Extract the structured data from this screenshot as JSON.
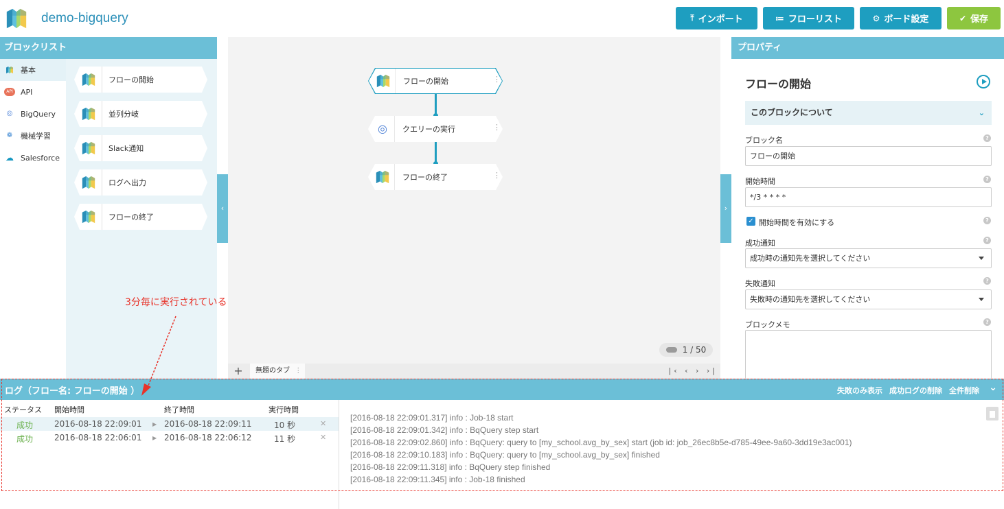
{
  "app": {
    "title": "demo-bigquery"
  },
  "header": {
    "import_label": "インポート",
    "flowlist_label": "フローリスト",
    "board_label": "ボード設定",
    "save_label": "保存"
  },
  "blocklist": {
    "title": "ブロックリスト",
    "categories": [
      {
        "label": "基本",
        "icon": "cube-icon"
      },
      {
        "label": "API",
        "icon": "api-icon"
      },
      {
        "label": "BigQuery",
        "icon": "bigquery-icon"
      },
      {
        "label": "機械学習",
        "icon": "brain-icon"
      },
      {
        "label": "Salesforce",
        "icon": "cloud-icon"
      }
    ],
    "blocks": [
      {
        "label": "フローの開始"
      },
      {
        "label": "並列分岐"
      },
      {
        "label": "Slack通知"
      },
      {
        "label": "ログへ出力"
      },
      {
        "label": "フローの終了"
      }
    ]
  },
  "canvas": {
    "nodes": [
      {
        "label": "フローの開始"
      },
      {
        "label": "クエリーの実行"
      },
      {
        "label": "フローの終了"
      }
    ],
    "page_counter": "1 / 50",
    "tabs": [
      {
        "label": "無題のタブ"
      }
    ],
    "tab_nav": "|‹ ‹ › ›|"
  },
  "properties": {
    "title": "プロパティ",
    "block_title": "フローの開始",
    "about_label": "このブロックについて",
    "block_name_label": "ブロック名",
    "block_name_value": "フローの開始",
    "start_time_label": "開始時間",
    "start_time_value": "*/3 * * * *",
    "enable_start_time_label": "開始時間を有効にする",
    "success_notify_label": "成功通知",
    "success_notify_value": "成功時の通知先を選択してください",
    "failure_notify_label": "失敗通知",
    "failure_notify_value": "失敗時の通知先を選択してください",
    "memo_label": "ブロックメモ"
  },
  "log": {
    "title": "ログ（フロー名: フローの開始 ）",
    "actions": {
      "show_failures": "失敗のみ表示",
      "delete_success": "成功ログの削除",
      "delete_all": "全件削除"
    },
    "columns": {
      "status": "ステータス",
      "start": "開始時間",
      "end": "終了時間",
      "duration": "実行時間"
    },
    "rows": [
      {
        "status": "成功",
        "start": "2016-08-18 22:09:01",
        "end": "2016-08-18 22:09:11",
        "duration": "10 秒"
      },
      {
        "status": "成功",
        "start": "2016-08-18 22:06:01",
        "end": "2016-08-18 22:06:12",
        "duration": "11 秒"
      }
    ],
    "lines": [
      "[2016-08-18 22:09:01.317]  info : Job-18 start",
      "[2016-08-18 22:09:01.342]  info : BqQuery step start",
      "[2016-08-18 22:09:02.860]  info : BqQuery: query to [my_school.avg_by_sex] start (job id: job_26ec8b5e-d785-49ee-9a60-3dd19e3ac001)",
      "[2016-08-18 22:09:10.183]  info : BqQuery: query to [my_school.avg_by_sex] finished",
      "[2016-08-18 22:09:11.318]  info : BqQuery step finished",
      "[2016-08-18 22:09:11.345]  info : Job-18 finished"
    ]
  },
  "annotation": {
    "text": "3分毎に実行されている",
    "color": "#e8332a"
  },
  "colors": {
    "accent": "#1e9ec0",
    "panel_header": "#6bbfd7",
    "save": "#8dc63f",
    "success": "#6ab04c"
  }
}
